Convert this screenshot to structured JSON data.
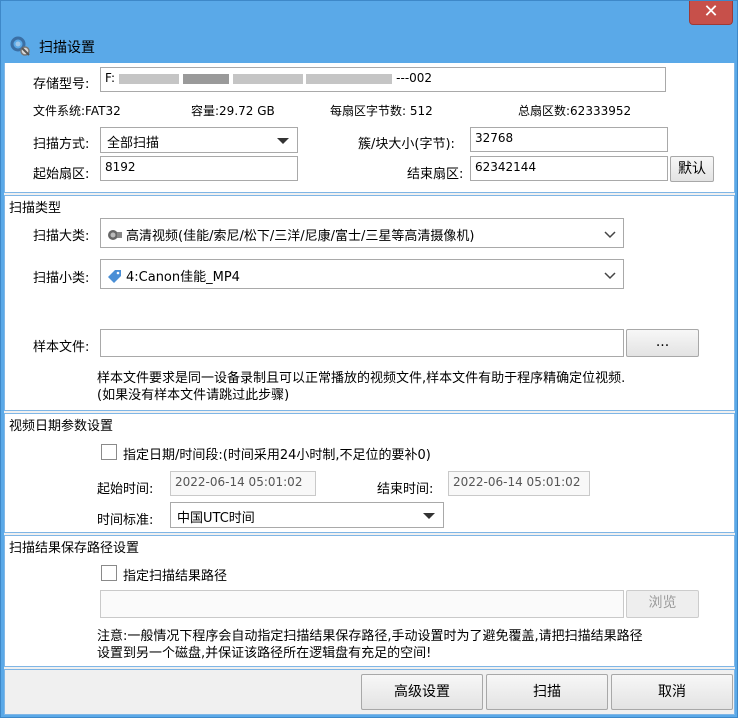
{
  "window": {
    "close_glyph": "✕"
  },
  "header": {
    "title": "扫描设置",
    "icon": "gear-magnifier-icon"
  },
  "device": {
    "model_label": "存储型号:",
    "model_value_prefix": "F:",
    "model_value_suffix": "---002",
    "filesystem": "文件系统:FAT32",
    "capacity": "容量:29.72 GB",
    "bytes_per_sector": "每扇区字节数: 512",
    "total_sectors": "总扇区数:62333952",
    "scan_mode_label": "扫描方式:",
    "scan_mode_value": "全部扫描",
    "cluster_label": "簇/块大小(字节):",
    "cluster_value": "32768",
    "start_sector_label": "起始扇区:",
    "start_sector_value": "8192",
    "end_sector_label": "结束扇区:",
    "end_sector_value": "62342144",
    "default_button": "默认"
  },
  "scan_type": {
    "group_title": "扫描类型",
    "category_label": "扫描大类:",
    "category_value": "高清视频(佳能/索尼/松下/三洋/尼康/富士/三星等高清摄像机)",
    "subcategory_label": "扫描小类:",
    "subcategory_value": "4:Canon佳能_MP4",
    "sample_label": "样本文件:",
    "sample_value": "",
    "browse_dots": "...",
    "sample_note": "样本文件要求是同一设备录制且可以正常播放的视频文件,样本文件有助于程序精确定位视频.(如果没有样本文件请跳过此步骤)"
  },
  "date_params": {
    "group_title": "视频日期参数设置",
    "checkbox_label": "指定日期/时间段:(时间采用24小时制,不足位的要补0)",
    "start_label": "起始时间:",
    "start_value": "2022-06-14 05:01:02",
    "end_label": "结束时间:",
    "end_value": "2022-06-14 05:01:02",
    "timezone_label": "时间标准:",
    "timezone_value": "中国UTC时间"
  },
  "save_path": {
    "group_title": "扫描结果保存路径设置",
    "checkbox_label": "指定扫描结果路径",
    "path_value": "",
    "browse_button": "浏览",
    "note": "注意:一般情况下程序会自动指定扫描结果保存路径,手动设置时为了避免覆盖,请把扫描结果路径设置到另一个磁盘,并保证该路径所在逻辑盘有充足的空间!"
  },
  "footer": {
    "advanced_button": "高级设置",
    "scan_button": "扫描",
    "cancel_button": "取消"
  },
  "colors": {
    "frame": "#5aa9e8",
    "panel_border": "#7fb6e6",
    "close": "#c7504a"
  }
}
